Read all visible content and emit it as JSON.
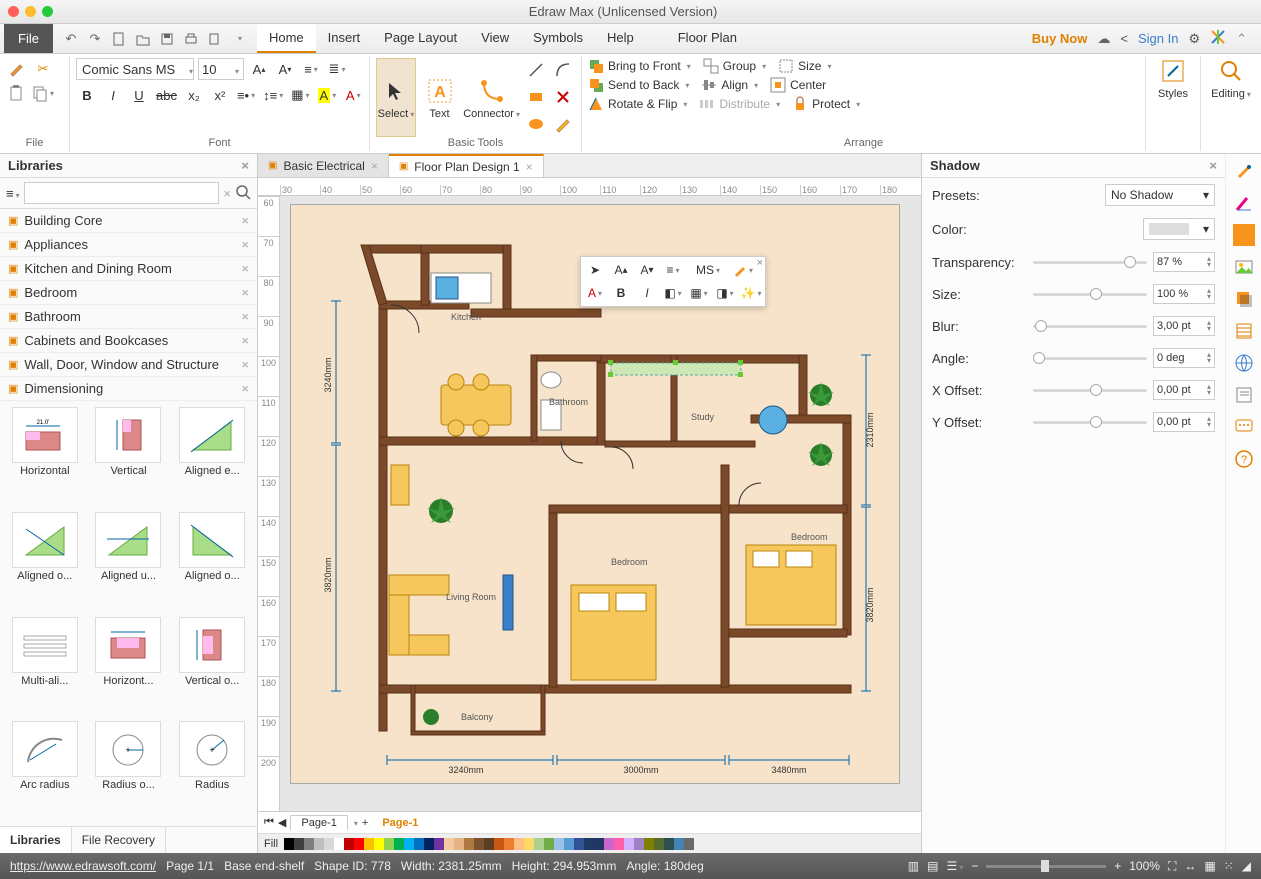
{
  "title": "Edraw Max (Unlicensed Version)",
  "file_menu": "File",
  "menu_tabs": [
    "Home",
    "Insert",
    "Page Layout",
    "View",
    "Symbols",
    "Help",
    "Floor Plan"
  ],
  "active_menu_tab": "Home",
  "menubar_right": {
    "buy_now": "Buy Now",
    "sign_in": "Sign In"
  },
  "ribbon": {
    "file_group": "File",
    "font_group": "Font",
    "font_name": "Comic Sans MS",
    "font_size": "10",
    "basic_tools": "Basic Tools",
    "select": "Select",
    "text": "Text",
    "connector": "Connector",
    "arrange_group": "Arrange",
    "bring_front": "Bring to Front",
    "send_back": "Send to Back",
    "rotate_flip": "Rotate & Flip",
    "group": "Group",
    "align": "Align",
    "distribute": "Distribute",
    "size": "Size",
    "center": "Center",
    "protect": "Protect",
    "styles": "Styles",
    "editing": "Editing"
  },
  "left_panel": {
    "title": "Libraries",
    "search_placeholder": "",
    "categories": [
      "Building Core",
      "Appliances",
      "Kitchen and Dining Room",
      "Bedroom",
      "Bathroom",
      "Cabinets and Bookcases",
      "Wall, Door, Window and Structure",
      "Dimensioning"
    ],
    "shapes": [
      "Horizontal",
      "Vertical",
      "Aligned e...",
      "Aligned o...",
      "Aligned u...",
      "Aligned o...",
      "Multi-ali...",
      "Horizont...",
      "Vertical o...",
      "Arc radius",
      "Radius o...",
      "Radius"
    ],
    "tabs": [
      "Libraries",
      "File Recovery"
    ]
  },
  "doc_tabs": [
    "Basic Electrical",
    "Floor Plan Design 1"
  ],
  "active_doc_tab": 1,
  "ruler_h": [
    "30",
    "40",
    "50",
    "60",
    "70",
    "80",
    "90",
    "100",
    "110",
    "120",
    "130",
    "140",
    "150",
    "160",
    "170",
    "180"
  ],
  "ruler_v": [
    "60",
    "70",
    "80",
    "90",
    "100",
    "110",
    "120",
    "130",
    "140",
    "150",
    "160",
    "170",
    "180",
    "190",
    "200"
  ],
  "page_tabs": {
    "main": "Page-1",
    "secondary": "Page-1"
  },
  "fill_label": "Fill",
  "floorplan_labels": {
    "kitchen": "Kitchen",
    "bathroom": "Bathroom",
    "study": "Study",
    "bedroom1": "Bedroom",
    "bedroom2": "Bedroom",
    "living": "Living Room",
    "balcony": "Balcony",
    "d3240": "3240mm",
    "d3820": "3820mm",
    "d2310": "2310mm",
    "d3820b": "3820mm",
    "d3240b": "3240mm",
    "d3000": "3000mm",
    "d3480": "3480mm"
  },
  "mini_toolbar_font": "MS",
  "right_panel": {
    "title": "Shadow",
    "presets_label": "Presets:",
    "preset_val": "No Shadow",
    "color_label": "Color:",
    "transparency_label": "Transparency:",
    "transparency_val": "87 %",
    "size_label": "Size:",
    "size_val": "100 %",
    "blur_label": "Blur:",
    "blur_val": "3,00 pt",
    "angle_label": "Angle:",
    "angle_val": "0 deg",
    "xoff_label": "X Offset:",
    "xoff_val": "0,00 pt",
    "yoff_label": "Y Offset:",
    "yoff_val": "0,00 pt"
  },
  "statusbar": {
    "url": "https://www.edrawsoft.com/",
    "page": "Page 1/1",
    "shape": "Base end-shelf",
    "shape_id": "Shape ID: 778",
    "width": "Width: 2381.25mm",
    "height": "Height: 294.953mm",
    "angle": "Angle: 180deg",
    "zoom": "100%"
  },
  "palette": [
    "#000",
    "#3f3f3f",
    "#7f7f7f",
    "#bfbfbf",
    "#d8d8d8",
    "#fff",
    "#c00000",
    "#ff0000",
    "#ffc000",
    "#ffff00",
    "#92d050",
    "#00b050",
    "#00b0f0",
    "#0070c0",
    "#002060",
    "#7030a0",
    "#f2c99e",
    "#e6b183",
    "#ae7843",
    "#7a5230",
    "#5c3d22",
    "#c65911",
    "#ed7d31",
    "#ffbf80",
    "#ffd966",
    "#a9d08e",
    "#70ad47",
    "#9bc2e6",
    "#5b9bd5",
    "#305496",
    "#1f3864",
    "#203764",
    "#c6c",
    "#ff5eaa",
    "#d0b0ff",
    "#a080c0",
    "#808000",
    "#556b2f",
    "#2f4f4f",
    "#4682b4",
    "#696969"
  ]
}
